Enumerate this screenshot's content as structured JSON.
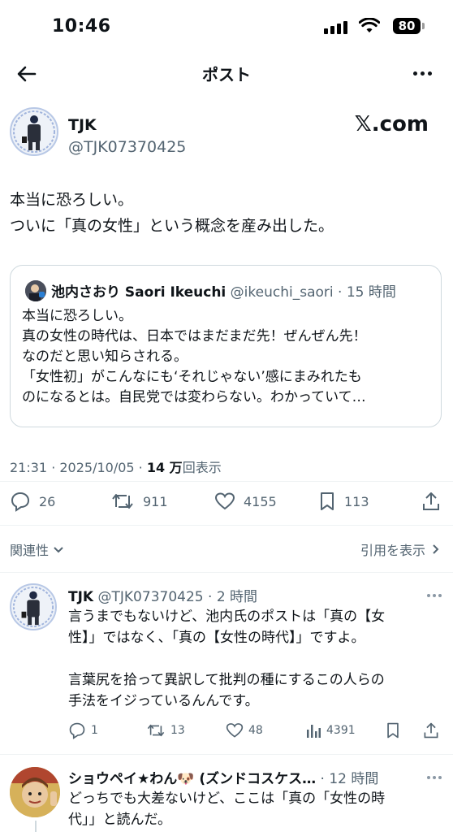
{
  "status_bar": {
    "time": "10:46",
    "battery": "80"
  },
  "header": {
    "title": "ポスト"
  },
  "post": {
    "author_name": "TJK",
    "author_handle": "@TJK07370425",
    "source_logo": "𝕏.com",
    "text_line1": "本当に恐ろしい。",
    "text_line2": "ついに「真の女性」という概念を産み出した。",
    "quote": {
      "author_name": "池内さおり Saori Ikeuchi",
      "author_handle": "@ikeuchi_saori",
      "time": "15 時間",
      "lines": [
        "本当に恐ろしい。",
        "真の女性の時代は、日本ではまだまだ先！ぜんぜん先！",
        "なのだと思い知らされる。",
        "「女性初」がこんなにも‘それじゃない’感にまみれたも",
        "のになるとは。自民党では変わらない。わかっていて…"
      ]
    },
    "timestamp": "21:31 · 2025/10/05 · ",
    "views_count": "14 万",
    "views_label": "回表示",
    "stats": {
      "replies": "26",
      "reposts": "911",
      "likes": "4155",
      "bookmarks": "113"
    }
  },
  "sort": {
    "relevance_label": "関連性",
    "show_quotes_label": "引用を表示"
  },
  "replies": [
    {
      "author_name": "TJK",
      "author_handle": "@TJK07370425",
      "time": "2 時間",
      "lines": [
        "言うまでもないけど、池内氏のポストは「真の【女",
        "性】」ではなく、「真の【女性の時代】」ですよ。",
        "",
        "言葉尻を拾って異訳して批判の種にするこの人らの",
        "手法をイジっているんんです。"
      ],
      "stats": {
        "replies": "1",
        "reposts": "13",
        "likes": "48",
        "views": "4391"
      }
    },
    {
      "author_name": "ショウペイ★わん🐶 (ズンドコスケス…",
      "time": "12 時間",
      "lines": [
        "どっちでも大差ないけど、ここは「真の「女性の時",
        "代」」と読んだ。"
      ]
    }
  ],
  "icons": [
    "back-arrow-icon",
    "more-icon",
    "reply-icon",
    "repost-icon",
    "like-icon",
    "bookmark-icon",
    "share-icon",
    "chevron-down-icon",
    "chevron-right-icon",
    "views-icon"
  ]
}
